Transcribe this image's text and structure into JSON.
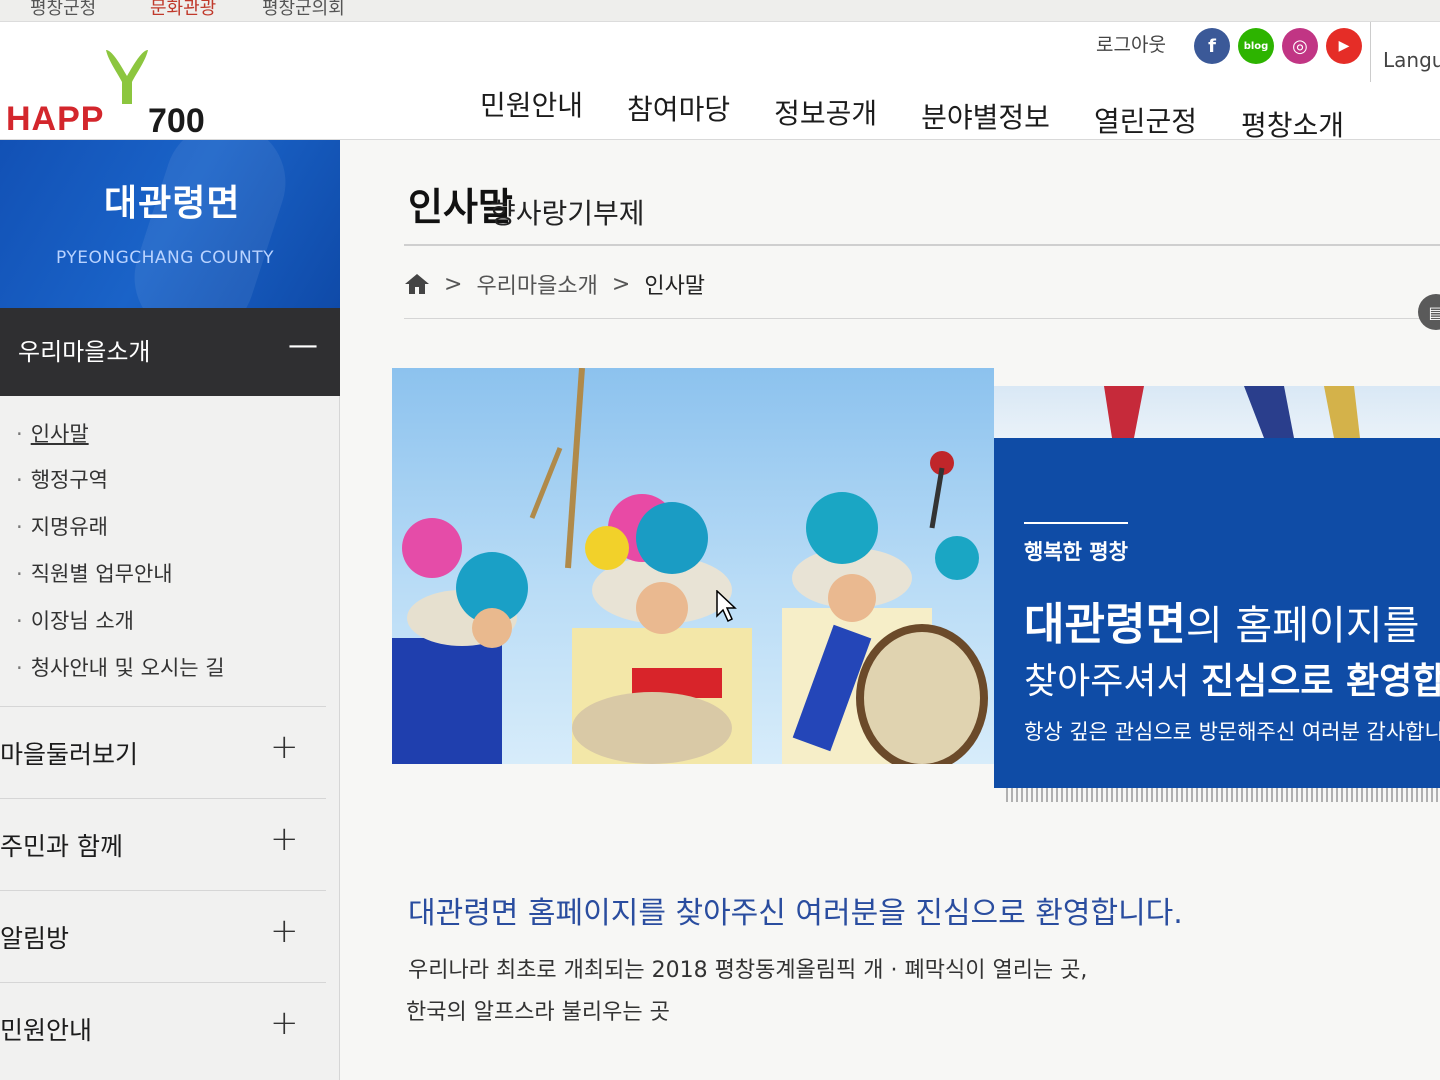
{
  "top_links": [
    "평창군청",
    "문화관광",
    "평창군의회"
  ],
  "header": {
    "logo_text": "HAPP",
    "logo_num": "700",
    "logout": "로그아웃",
    "social": [
      {
        "name": "facebook",
        "glyph": "f",
        "color": "#3b5998"
      },
      {
        "name": "blog",
        "glyph": "blog",
        "color": "#2db400"
      },
      {
        "name": "instagram",
        "glyph": "◎",
        "color": "#c13584"
      },
      {
        "name": "youtube",
        "glyph": "▶",
        "color": "#e52d27"
      }
    ],
    "language": "Langu",
    "gnb": [
      "민원안내",
      "참여마당",
      "정보공개",
      "분야별정보",
      "열린군정",
      "평창소개"
    ]
  },
  "sidebar": {
    "title": "대관령면",
    "subtitle": "PYEONGCHANG COUNTY",
    "open_category": {
      "label": "우리마을소개",
      "toggle": "—"
    },
    "sub_items": [
      "인사말",
      "행정구역",
      "지명유래",
      "직원별 업무안내",
      "이장님 소개",
      "청사안내 및 오시는 길"
    ],
    "categories": [
      {
        "label": "마을둘러보기",
        "toggle": "+"
      },
      {
        "label": "주민과 함께",
        "toggle": "+"
      },
      {
        "label": "알림방",
        "toggle": "+"
      },
      {
        "label": "민원안내",
        "toggle": "+"
      }
    ]
  },
  "main": {
    "title": "인사말",
    "title_overlap": "향사랑기부제",
    "breadcrumb": [
      "우리마을소개",
      "인사말"
    ],
    "banner": {
      "kicker": "행복한 평창",
      "line1_strong": "대관령면",
      "line1_rest": "의 홈페이지를",
      "line2_a": "찾아주셔서 ",
      "line2_strong": "진심으로 환영합니",
      "line3": "항상 깊은 관심으로 방문해주신 여러분 감사합니"
    },
    "lead": "대관령면 홈페이지를 찾아주신 여러분을 진심으로 환영합니다.",
    "body_line1": "우리나라 최초로 개최되는 2018 평창동계올림픽 개 · 폐막식이 열리는 곳,",
    "body_line2": "한국의 알프스라 불리우는 곳"
  }
}
